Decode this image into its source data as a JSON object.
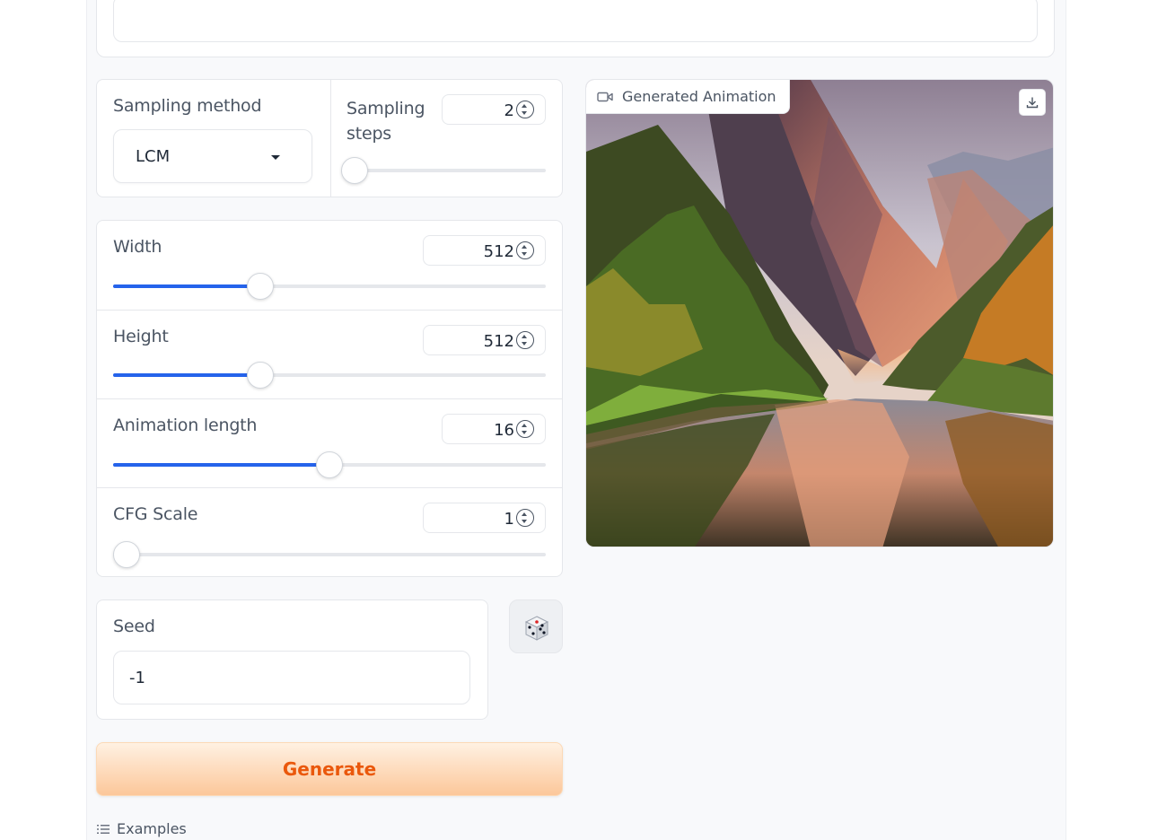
{
  "sampling": {
    "method_label": "Sampling method",
    "method_value": "LCM",
    "steps_label": "Sampling steps",
    "steps_value": "2",
    "steps_level": 0.04
  },
  "sliders": [
    {
      "label": "Width",
      "value": "512",
      "level": 0.34
    },
    {
      "label": "Height",
      "value": "512",
      "level": 0.34
    },
    {
      "label": "Animation length",
      "value": "16",
      "level": 0.5
    },
    {
      "label": "CFG Scale",
      "value": "1",
      "level": 0.0
    }
  ],
  "seed": {
    "label": "Seed",
    "value": "-1"
  },
  "dice_icon": "dice-icon",
  "generate_label": "Generate",
  "examples_label": "Examples",
  "output": {
    "label": "Generated Animation",
    "icons": [
      "video-camera-icon",
      "download-icon"
    ]
  },
  "colors": {
    "accent": "#2563eb",
    "generate_text": "#ea580c",
    "generate_bg_top": "#fff1e2",
    "generate_bg_bottom": "#fcc79a"
  }
}
